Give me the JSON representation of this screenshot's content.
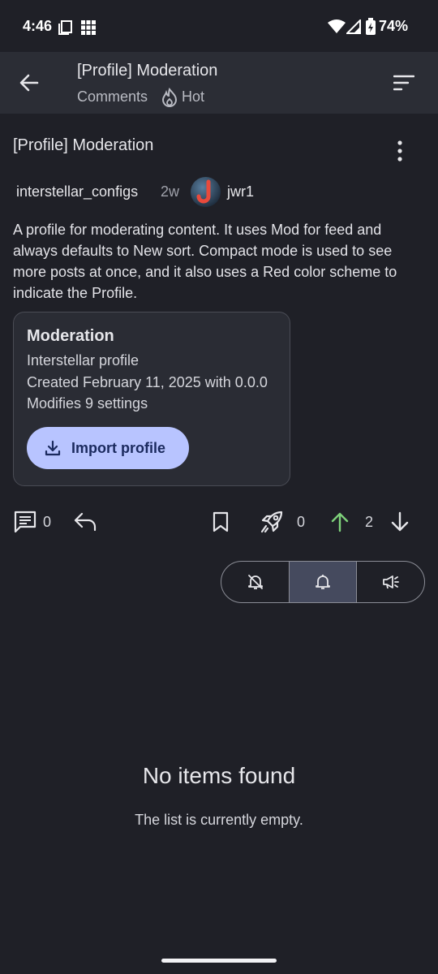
{
  "status_bar": {
    "time": "4:46",
    "battery": "74%",
    "icons": [
      "screenshot-icon",
      "apps-grid-icon",
      "wifi-icon",
      "signal-icon",
      "battery-icon"
    ]
  },
  "app_bar": {
    "title": "[Profile] Moderation",
    "subtitle_left": "Comments",
    "subtitle_right": "Hot",
    "icons": [
      "back-arrow-icon",
      "flame-icon",
      "sort-icon"
    ]
  },
  "post": {
    "title": "[Profile] Moderation",
    "community": "interstellar_configs",
    "age": "2w",
    "author": "jwr1",
    "body": "A profile for moderating content. It uses Mod for feed and always defaults to New sort. Compact mode is used to see more posts at once, and it also uses a Red color scheme to indicate the Profile.",
    "card": {
      "title": "Moderation",
      "line1": "Interstellar profile",
      "line2": "Created February 11, 2025 with 0.0.0",
      "line3": "Modifies 9 settings",
      "button_label": "Import profile"
    },
    "actions": {
      "comments_count": "0",
      "boost_count": "0",
      "score": "2"
    }
  },
  "notification_toggle": {
    "options": [
      "notifications-off-icon",
      "notifications-icon",
      "announcement-icon"
    ],
    "selected_index": 1
  },
  "empty_state": {
    "title": "No items found",
    "subtitle": "The list is currently empty."
  },
  "colors": {
    "background": "#1f2027",
    "app_bar": "#2b2d35",
    "accent_button": "#b8c4ff",
    "upvote_green": "#7ed17a"
  }
}
